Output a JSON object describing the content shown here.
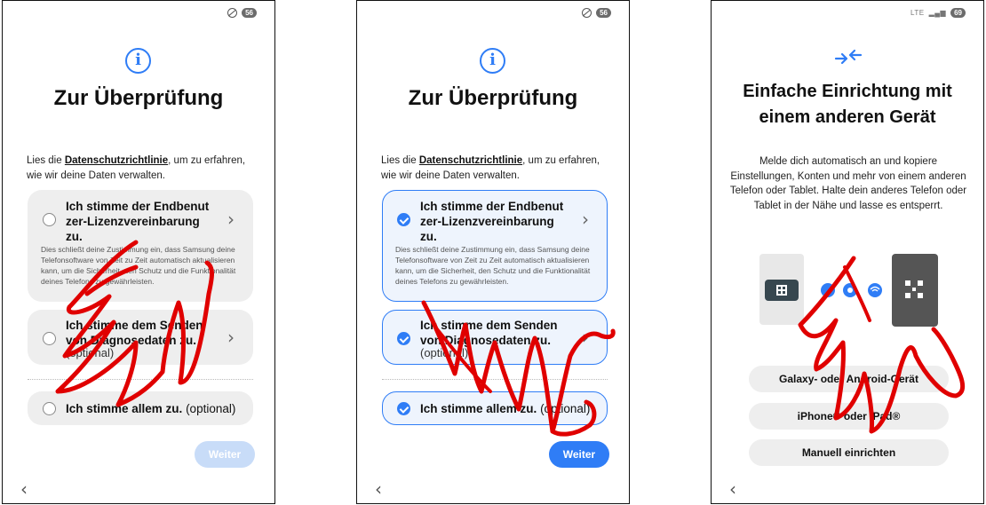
{
  "phone1": {
    "title": "Zur Überprüfung",
    "lead_pre": "Lies die ",
    "lead_link": "Datenschutzrichtlinie",
    "lead_post": ", um zu erfahren, wie wir deine Daten verwalten.",
    "eula_title": "Ich stimme der Endbenut zer-Lizenzvereinbarung zu.",
    "eula_desc": "Dies schließt deine Zustimmung ein, dass Samsung deine Telefonsoftware von Zeit zu Zeit automatisch aktualisieren kann, um die Sicherheit, den Schutz und die Funktionalität deines Telefons zu gewährleisten.",
    "diag_title": "Ich stimme dem Senden von Diagnosedaten zu.",
    "diag_optional": "(optional)",
    "all_label": "Ich stimme allem zu.",
    "all_optional": "(optional)",
    "next": "Weiter",
    "back": "‹"
  },
  "phone2": {
    "title": "Zur Überprüfung",
    "lead_pre": "Lies die ",
    "lead_link": "Datenschutzrichtlinie",
    "lead_post": ", um zu erfahren, wie wir deine Daten verwalten.",
    "eula_title": "Ich stimme der Endbenut zer-Lizenzvereinbarung zu.",
    "eula_desc": "Dies schließt deine Zustimmung ein, dass Samsung deine Telefonsoftware von Zeit zu Zeit automatisch aktualisieren kann, um die Sicherheit, den Schutz und die Funktionalität deines Telefons zu gewährleisten.",
    "diag_title": "Ich stimme dem Senden von Diagnosedaten zu.",
    "diag_optional": "(optional)",
    "all_label": "Ich stimme allem zu.",
    "all_optional": "(optional)",
    "next": "Weiter",
    "back": "‹"
  },
  "phone3": {
    "title": "Einfache Einrichtung mit einem anderen Gerät",
    "desc": "Melde dich automatisch an und kopiere Einstellungen, Konten und mehr von einem anderen Telefon oder Tablet. Halte dein anderes Telefon oder Tablet in der Nähe und lasse es entsperrt.",
    "btn_galaxy": "Galaxy- oder Android-Gerät",
    "btn_iphone": "iPhone® oder iPad®",
    "btn_manual": "Manuell einrichten",
    "back": "‹",
    "status_lte": "LTE",
    "status_battery": "69"
  },
  "status": {
    "battery": "56"
  },
  "colors": {
    "accent": "#2f7df6",
    "scribble": "#e00000",
    "card_bg": "#eeeeee"
  },
  "icons": [
    "info-icon",
    "radio-icon",
    "chevron-right-icon",
    "transfer-arrows-icon",
    "qr-code-icon",
    "settings-icon",
    "wifi-icon",
    "back-arrow-icon",
    "do-not-disturb-icon",
    "battery-icon"
  ]
}
